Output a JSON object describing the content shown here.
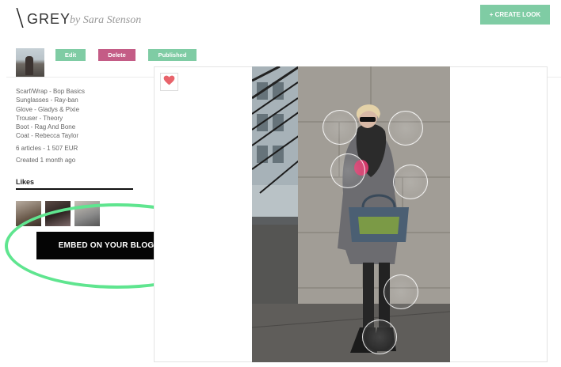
{
  "header": {
    "slash": "\\",
    "title": "GREY",
    "byline": "by Sara Stenson",
    "create_button": "+ CREATE LOOK"
  },
  "actions": {
    "edit": "Edit",
    "delete": "Delete",
    "published": "Published"
  },
  "items": [
    "Scarf/Wrap - Bop Basics",
    "Sunglasses - Ray-ban",
    "Glove - Gladys & Pixie",
    "Trouser - Theory",
    "Boot - Rag And Bone",
    "Coat - Rebecca Taylor"
  ],
  "summary": {
    "articles": "6 articles - 1 507 EUR",
    "created": "Created 1 month ago"
  },
  "likes": {
    "heading": "Likes"
  },
  "embed": {
    "button": "EMBED ON YOUR BLOG / SITE"
  },
  "colors": {
    "accent_green": "#7fcca4",
    "delete_pink": "#c45c86",
    "highlight_green": "#5fe58f",
    "heart": "#e8636b"
  },
  "icons": {
    "like": "heart-icon"
  }
}
